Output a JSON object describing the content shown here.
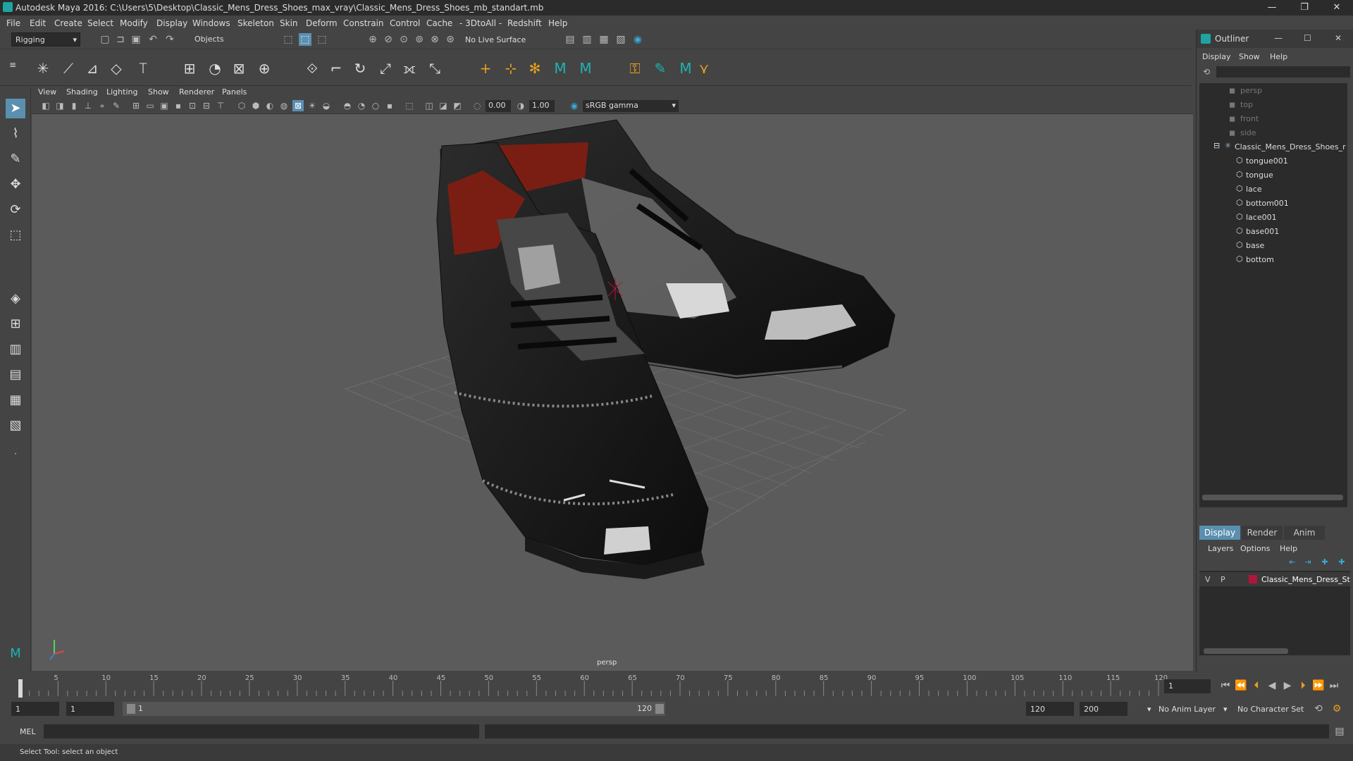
{
  "window": {
    "title": "Autodesk Maya 2016: C:\\Users\\5\\Desktop\\Classic_Mens_Dress_Shoes_max_vray\\Classic_Mens_Dress_Shoes_mb_standart.mb",
    "minimize": "—",
    "maximize": "❐",
    "close": "✕"
  },
  "menubar": [
    "File",
    "Edit",
    "Create",
    "Select",
    "Modify",
    "Display",
    "Windows",
    "Skeleton",
    "Skin",
    "Deform",
    "Constrain",
    "Control",
    "Cache",
    "- 3DtoAll -",
    "Redshift",
    "Help"
  ],
  "statusline": {
    "menuset": "Rigging",
    "selection_mode": "Objects",
    "live_surface": "No Live Surface"
  },
  "panel": {
    "menus": [
      "View",
      "Shading",
      "Lighting",
      "Show",
      "Renderer",
      "Panels"
    ],
    "exposure": "0.00",
    "gamma": "1.00",
    "color_space": "sRGB gamma",
    "camera_label": "persp"
  },
  "outliner": {
    "title": "Outliner",
    "menus": [
      "Display",
      "Show",
      "Help"
    ],
    "items": [
      {
        "label": "persp",
        "type": "camera"
      },
      {
        "label": "top",
        "type": "camera"
      },
      {
        "label": "front",
        "type": "camera"
      },
      {
        "label": "side",
        "type": "camera"
      },
      {
        "label": "Classic_Mens_Dress_Shoes_r",
        "type": "group"
      },
      {
        "label": "tongue001",
        "type": "mesh"
      },
      {
        "label": "tongue",
        "type": "mesh"
      },
      {
        "label": "lace",
        "type": "mesh"
      },
      {
        "label": "bottom001",
        "type": "mesh"
      },
      {
        "label": "lace001",
        "type": "mesh"
      },
      {
        "label": "base001",
        "type": "mesh"
      },
      {
        "label": "base",
        "type": "mesh"
      },
      {
        "label": "bottom",
        "type": "mesh"
      }
    ]
  },
  "layer_editor": {
    "tabs": [
      "Display",
      "Render",
      "Anim"
    ],
    "menus": [
      "Layers",
      "Options",
      "Help"
    ],
    "layer": {
      "v": "V",
      "p": "P",
      "name": "Classic_Mens_Dress_St",
      "color": "#b0163a"
    }
  },
  "timeline": {
    "ticks": [
      "1",
      "5",
      "10",
      "15",
      "20",
      "25",
      "30",
      "35",
      "40",
      "45",
      "50",
      "55",
      "60",
      "65",
      "70",
      "75",
      "80",
      "85",
      "90",
      "95",
      "100",
      "105",
      "110",
      "115",
      "120"
    ],
    "current_frame": "1",
    "current_frame_value": 1
  },
  "range": {
    "start": "1",
    "playback_start": "1",
    "slider_start": "1",
    "slider_end": "120",
    "playback_end": "120",
    "end": "200",
    "anim_layer": "No Anim Layer",
    "character_set": "No Character Set"
  },
  "cmdline": {
    "label": "MEL"
  },
  "helpline": {
    "text": "Select Tool: select an object"
  },
  "colors": {
    "accent": "#1fa3a3",
    "viewport_bg": "#5b5b5b",
    "layer_color": "#b0163a"
  },
  "icons": {
    "play": "play-forward-icon",
    "rewind": "rewind-icon"
  }
}
